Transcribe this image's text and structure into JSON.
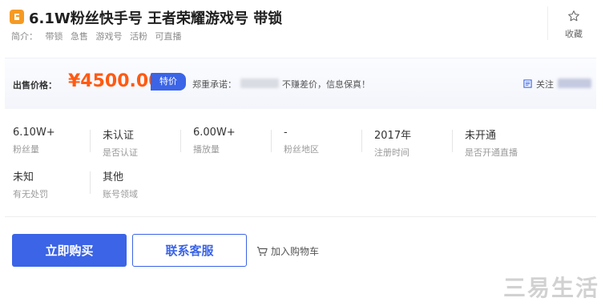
{
  "header": {
    "title": "6.1W粉丝快手号 王者荣耀游戏号 带锁",
    "summary_label": "简介：",
    "summary_tags": [
      "带锁",
      "急售",
      "游戏号",
      "活粉",
      "可直播"
    ],
    "favorite_label": "收藏"
  },
  "price_band": {
    "price_label": "出售价格：",
    "price": "¥4500.00",
    "tag": "特价",
    "promise_label": "郑重承诺：",
    "promise_text": "不赚差价，信息保真！",
    "follow_label": "关注"
  },
  "info": [
    {
      "value": "6.10W+",
      "key": "粉丝量"
    },
    {
      "value": "未认证",
      "key": "是否认证"
    },
    {
      "value": "6.00W+",
      "key": "播放量"
    },
    {
      "value": "-",
      "key": "粉丝地区"
    },
    {
      "value": "2017年",
      "key": "注册时间"
    },
    {
      "value": "未开通",
      "key": "是否开通直播"
    },
    {
      "value": "未知",
      "key": "有无处罚"
    },
    {
      "value": "其他",
      "key": "账号领域"
    }
  ],
  "actions": {
    "buy_label": "立即购买",
    "cs_label": "联系客服",
    "cart_label": "加入购物车"
  },
  "watermark": "三易生活",
  "colors": {
    "accent": "#3b64e6",
    "price": "#ff5a12",
    "logo": "#f59a23"
  },
  "icons": {
    "logo": "app-logo-icon",
    "favorite": "star-icon",
    "follow": "follow-icon",
    "cart": "cart-icon"
  }
}
